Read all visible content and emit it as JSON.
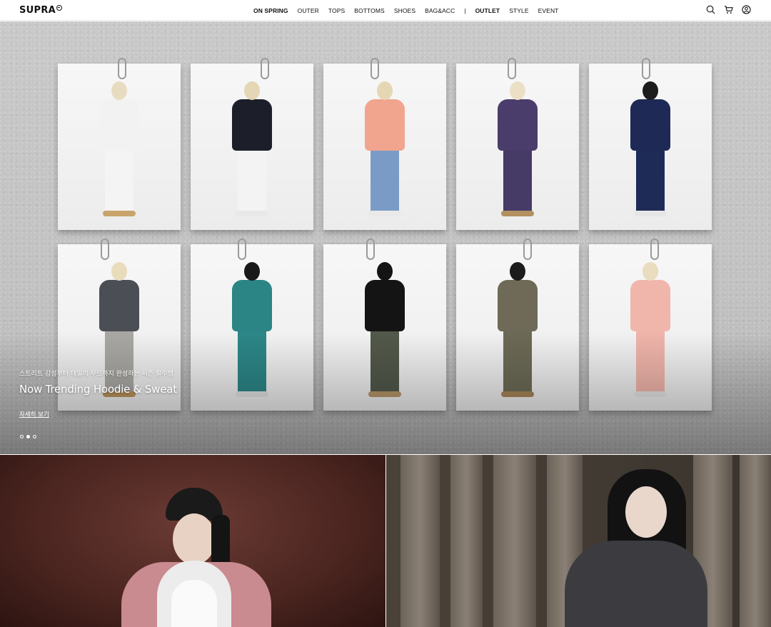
{
  "header": {
    "logo": "SUPRA",
    "nav": [
      {
        "label": "ON SPRING",
        "bold": true
      },
      {
        "label": "OUTER",
        "bold": false
      },
      {
        "label": "TOPS",
        "bold": false
      },
      {
        "label": "BOTTOMS",
        "bold": false
      },
      {
        "label": "SHOES",
        "bold": false
      },
      {
        "label": "BAG&ACC",
        "bold": false
      },
      {
        "label": "|",
        "separator": true
      },
      {
        "label": "OUTLET",
        "bold": true
      },
      {
        "label": "STYLE",
        "bold": false
      },
      {
        "label": "EVENT",
        "bold": false
      }
    ],
    "icons": [
      "search-icon",
      "cart-icon",
      "user-icon"
    ]
  },
  "hero": {
    "caption": "스트리트 감성부터 데일리 무드까지 완성하는 시즌 필수템",
    "title": "Now Trending Hoodie & Sweat",
    "link": "자세히 보기",
    "slides_total": 3,
    "active_slide": 2,
    "cards": [
      {
        "top": "#f2f2f2",
        "bottom": "#f4f4f4",
        "hair": "#e8dcc0",
        "shoes": "#c9a46a"
      },
      {
        "top": "#1c1f2a",
        "bottom": "#f3f3f3",
        "hair": "#e5d6b5",
        "shoes": "#e8e8e8"
      },
      {
        "top": "#f1a48e",
        "bottom": "#7b9bc7",
        "hair": "#e6d7b4",
        "shoes": "#e9e9e9"
      },
      {
        "top": "#4a3d6b",
        "bottom": "#463a66",
        "hair": "#ebe0c6",
        "shoes": "#b39060"
      },
      {
        "top": "#1e2a55",
        "bottom": "#1f2b57",
        "hair": "#1c1c1c",
        "shoes": "#e6e6e6"
      },
      {
        "top": "#4b4e55",
        "bottom": "#a9a7a3",
        "hair": "#e8dcbc",
        "shoes": "#b9935c"
      },
      {
        "top": "#2b8584",
        "bottom": "#2c8687",
        "hair": "#181818",
        "shoes": "#e0e0e0"
      },
      {
        "top": "#141414",
        "bottom": "#52584a",
        "hair": "#141414",
        "shoes": "#b59468"
      },
      {
        "top": "#6e6a57",
        "bottom": "#6c6a56",
        "hair": "#1c1c1c",
        "shoes": "#a68457"
      },
      {
        "top": "#f0b6ac",
        "bottom": "#efb4aa",
        "hair": "#e9dcbf",
        "shoes": "#e4e4e4"
      }
    ]
  },
  "colors": {
    "accent_text": "#111111",
    "hero_bg": "#c5c5c5"
  }
}
